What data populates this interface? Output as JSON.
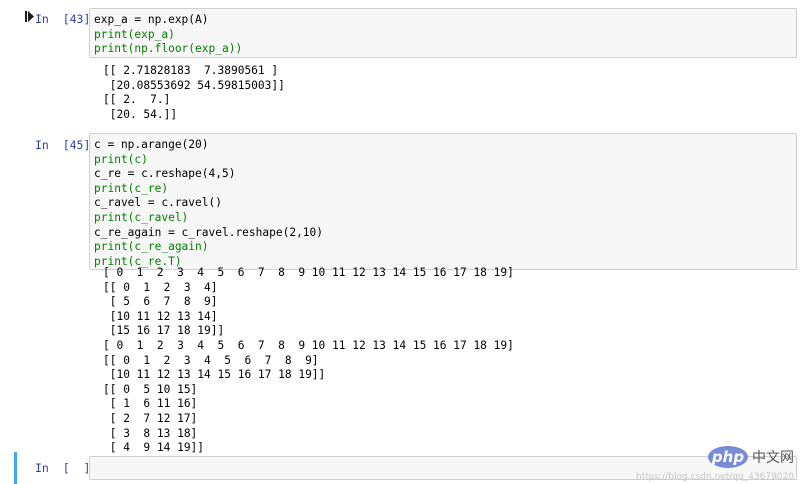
{
  "cells": [
    {
      "prompt": "In  [43]:",
      "code_lines": [
        "exp_a = np.exp(A)",
        "print(exp_a)",
        "print(np.floor(exp_a))"
      ],
      "output": "[[ 2.71828183  7.3890561 ]\n [20.08553692 54.59815003]]\n[[ 2.  7.]\n [20. 54.]]"
    },
    {
      "prompt": "In  [45]:",
      "code_lines": [
        "c = np.arange(20)",
        "print(c)",
        "c_re = c.reshape(4,5)",
        "print(c_re)",
        "c_ravel = c.ravel()",
        "print(c_ravel)",
        "c_re_again = c_ravel.reshape(2,10)",
        "print(c_re_again)",
        "print(c_re.T)"
      ],
      "output": "[ 0  1  2  3  4  5  6  7  8  9 10 11 12 13 14 15 16 17 18 19]\n[[ 0  1  2  3  4]\n [ 5  6  7  8  9]\n [10 11 12 13 14]\n [15 16 17 18 19]]\n[ 0  1  2  3  4  5  6  7  8  9 10 11 12 13 14 15 16 17 18 19]\n[[ 0  1  2  3  4  5  6  7  8  9]\n [10 11 12 13 14 15 16 17 18 19]]\n[[ 0  5 10 15]\n [ 1  6 11 16]\n [ 2  7 12 17]\n [ 3  8 13 18]\n [ 4  9 14 19]]"
    },
    {
      "prompt": "In  [  ]:",
      "code_lines": [
        ""
      ]
    }
  ],
  "watermark": {
    "logo": "php",
    "site": "中文网",
    "url": "https://blog.csdn.net/qq_43679020"
  },
  "colors": {
    "prompt": "#303f9f",
    "selected_bar": "#42a5f5",
    "input_bg": "#f7f7f7"
  },
  "icons": {
    "run": "run-cell-icon"
  }
}
